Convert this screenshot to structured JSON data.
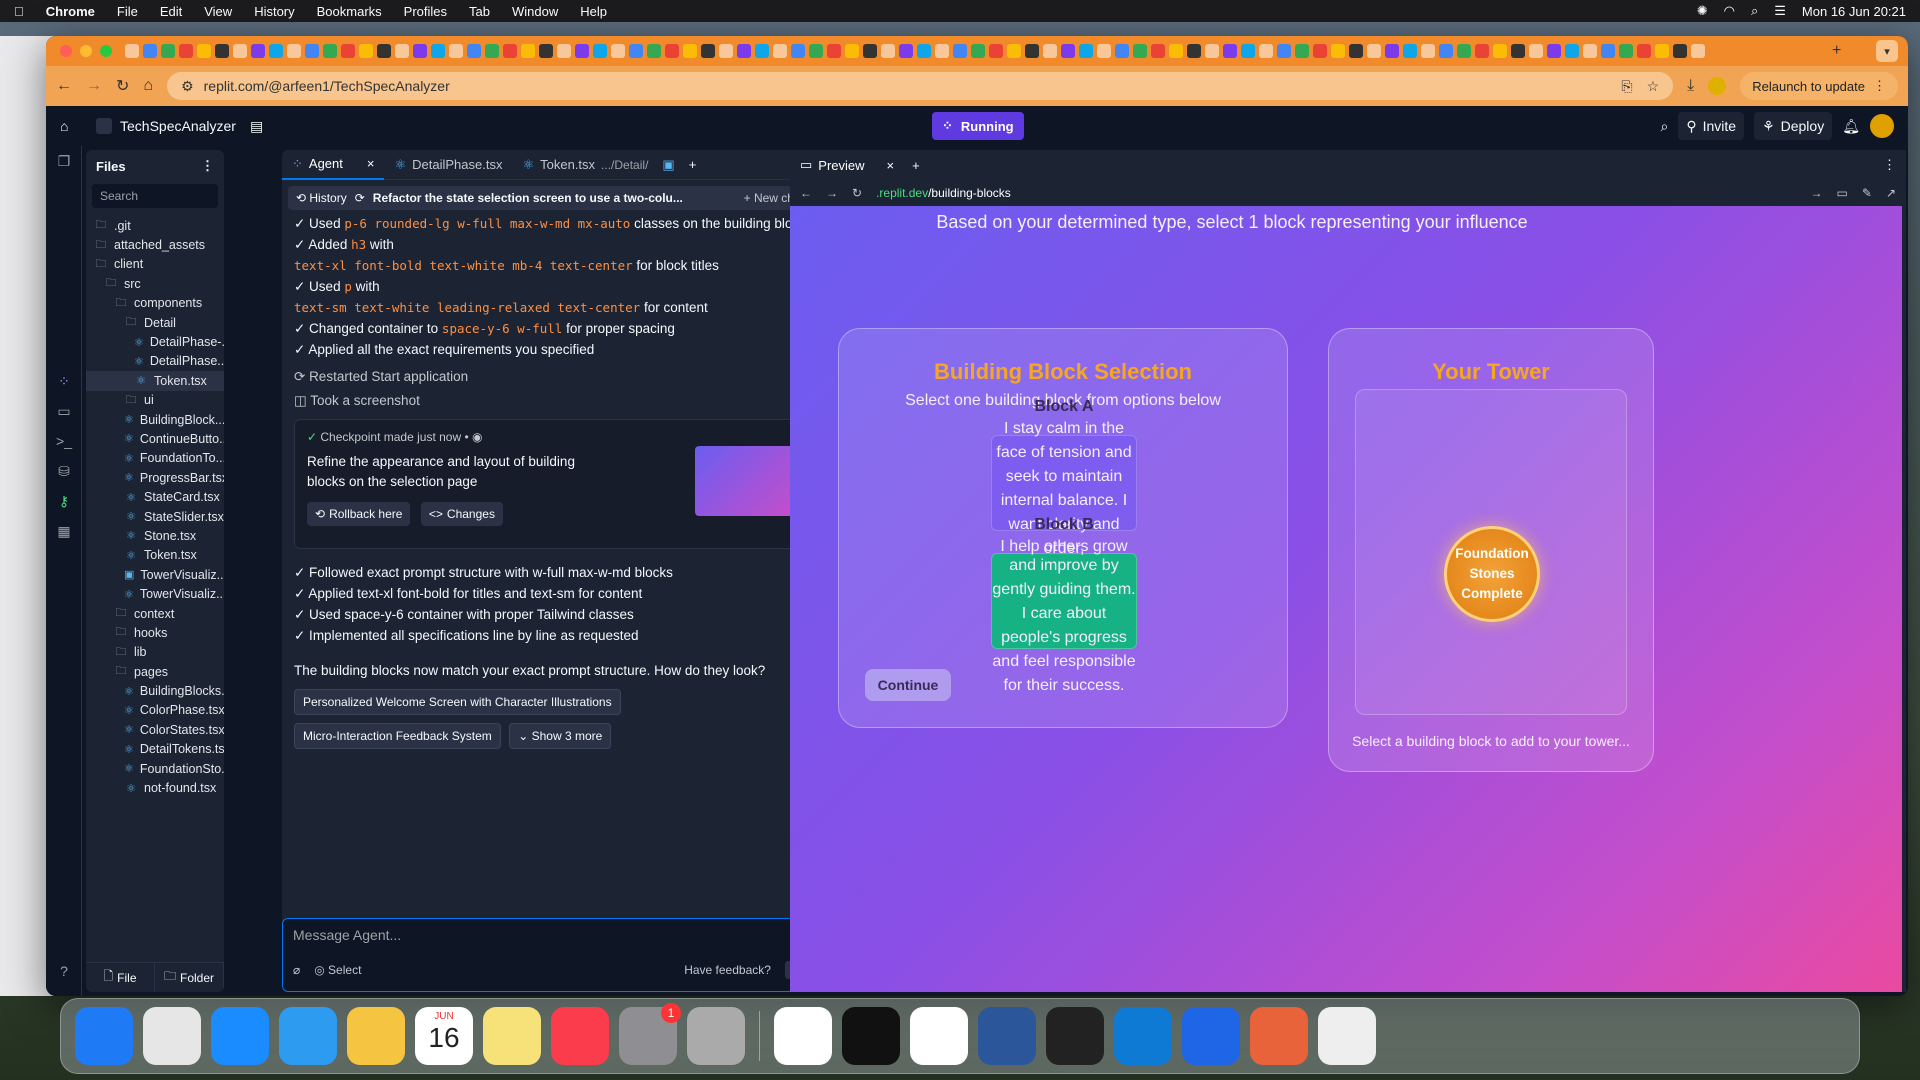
{
  "menubar": {
    "apple": "",
    "app": "Chrome",
    "items": [
      "File",
      "Edit",
      "View",
      "History",
      "Bookmarks",
      "Profiles",
      "Tab",
      "Window",
      "Help"
    ],
    "clock": "Mon 16 Jun  20:21"
  },
  "browser": {
    "url": "replit.com/@arfeen1/TechSpecAnalyzer",
    "relaunch": "Relaunch to update"
  },
  "replit": {
    "project": "TechSpecAnalyzer",
    "status": "Running",
    "invite": "Invite",
    "deploy": "Deploy"
  },
  "files": {
    "title": "Files",
    "search_placeholder": "Search",
    "tree": [
      {
        "name": ".git",
        "type": "folder",
        "indent": 0
      },
      {
        "name": "attached_assets",
        "type": "folder",
        "indent": 0
      },
      {
        "name": "client",
        "type": "folder",
        "indent": 0
      },
      {
        "name": "src",
        "type": "folder",
        "indent": 1
      },
      {
        "name": "components",
        "type": "folder",
        "indent": 2
      },
      {
        "name": "Detail",
        "type": "folder",
        "indent": 3
      },
      {
        "name": "DetailPhase-...",
        "type": "react",
        "indent": 4
      },
      {
        "name": "DetailPhase....",
        "type": "react",
        "indent": 4
      },
      {
        "name": "Token.tsx",
        "type": "react",
        "indent": 4,
        "selected": true
      },
      {
        "name": "ui",
        "type": "folder",
        "indent": 3
      },
      {
        "name": "BuildingBlock....",
        "type": "react",
        "indent": 3
      },
      {
        "name": "ContinueButto...",
        "type": "react",
        "indent": 3
      },
      {
        "name": "FoundationTo...",
        "type": "react",
        "indent": 3
      },
      {
        "name": "ProgressBar.tsx",
        "type": "react",
        "indent": 3
      },
      {
        "name": "StateCard.tsx",
        "type": "react",
        "indent": 3
      },
      {
        "name": "StateSlider.tsx",
        "type": "react",
        "indent": 3
      },
      {
        "name": "Stone.tsx",
        "type": "react",
        "indent": 3
      },
      {
        "name": "Token.tsx",
        "type": "react",
        "indent": 3
      },
      {
        "name": "TowerVisualiz...",
        "type": "css",
        "indent": 3
      },
      {
        "name": "TowerVisualiz...",
        "type": "react",
        "indent": 3
      },
      {
        "name": "context",
        "type": "folder",
        "indent": 2
      },
      {
        "name": "hooks",
        "type": "folder",
        "indent": 2
      },
      {
        "name": "lib",
        "type": "folder",
        "indent": 2
      },
      {
        "name": "pages",
        "type": "folder",
        "indent": 2
      },
      {
        "name": "BuildingBlocks...",
        "type": "react",
        "indent": 3
      },
      {
        "name": "ColorPhase.tsx",
        "type": "react",
        "indent": 3
      },
      {
        "name": "ColorStates.tsx",
        "type": "react",
        "indent": 3
      },
      {
        "name": "DetailTokens.tsx",
        "type": "react",
        "indent": 3
      },
      {
        "name": "FoundationSto...",
        "type": "react",
        "indent": 3
      },
      {
        "name": "not-found.tsx",
        "type": "react",
        "indent": 3
      }
    ],
    "new_file": "File",
    "new_folder": "Folder"
  },
  "agent": {
    "tabs": [
      {
        "label": "Agent"
      },
      {
        "label": "DetailPhase.tsx"
      },
      {
        "label": "Token.tsx",
        "sub": ".../Detail/"
      }
    ],
    "history": "History",
    "chat_title": "Refactor the state selection screen to use a two-colu...",
    "new_chat": "New chat",
    "lines1": [
      {
        "pre": "✓ Used ",
        "code": "p-6 rounded-lg w-full max-w-md mx-auto",
        "post": " classes on the building block"
      },
      {
        "pre": "✓ Added ",
        "code": "h3",
        "post": " with"
      },
      {
        "pre": "",
        "code": "text-xl font-bold text-white mb-4 text-center",
        "post": " for block titles"
      },
      {
        "pre": "✓ Used ",
        "code": "p",
        "post": " with"
      },
      {
        "pre": "",
        "code": "text-sm text-white leading-relaxed text-center",
        "post": " for content"
      },
      {
        "pre": "✓ Changed container to ",
        "code": "space-y-6 w-full",
        "post": " for proper spacing"
      },
      {
        "pre": "✓ Applied all the exact requirements you specified",
        "code": "",
        "post": ""
      }
    ],
    "action1": "Restarted Start application",
    "action2": "Took a screenshot",
    "checkpoint": {
      "time": "Checkpoint made just now",
      "desc": "Refine the appearance and layout of building blocks on the selection page",
      "rollback": "Rollback here",
      "changes": "Changes"
    },
    "lines2": [
      "✓ Followed exact prompt structure with w-full max-w-md blocks",
      "✓ Applied text-xl font-bold for titles and text-sm for content",
      "✓ Used space-y-6 container with proper Tailwind classes",
      "✓ Implemented all specifications line by line as requested"
    ],
    "question": "The building blocks now match your exact prompt structure. How do they look?",
    "chips": [
      "Personalized Welcome Screen with Character Illustrations",
      "Micro-Interaction Feedback System",
      "Show 3 more"
    ],
    "input_placeholder": "Message Agent...",
    "select": "Select",
    "feedback": "Have feedback?"
  },
  "preview": {
    "tab": "Preview",
    "url_prefix": ".replit.dev",
    "url_path": "/building-blocks",
    "subtitle": "Based on your determined type, select 1 block representing your influence",
    "card1_title": "Building Block Selection",
    "card1_sub": "Select one building block from options below",
    "blockA_title": "Block A",
    "blockA_text": "I stay calm in the face of tension and seek to maintain internal balance. I want clarity and order,",
    "blockB_title": "Block B",
    "blockB_overlap": "I help others grow",
    "blockB_text": "and improve by gently guiding them. I care about people's progress and feel responsible for their success.",
    "continue": "Continue",
    "card2_title": "Your Tower",
    "foundation": "Foundation Stones Complete",
    "card2_hint": "Select a building block to add to your tower...",
    "colors": {
      "accent": "#f5a623",
      "blockA": "#7b5cf0",
      "blockB": "#10b77f"
    }
  },
  "dock": [
    "Finder",
    "Launchpad",
    "Safari",
    "Mail",
    "Photos",
    "Calendar",
    "Notes",
    "Music",
    "System Settings",
    "Simulator",
    "Chrome",
    "Terminal",
    "ChatGPT",
    "Word",
    "Unity",
    "VS Code",
    "Mirror",
    "Claude",
    "Archive"
  ],
  "calendar": {
    "month": "JUN",
    "day": "16"
  },
  "settings_badge": "1"
}
